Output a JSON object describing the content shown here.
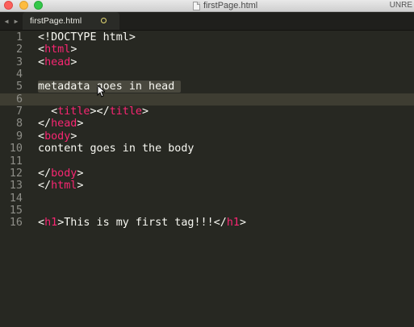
{
  "window": {
    "title": "firstPage.html",
    "unregistered": "UNRE"
  },
  "tab": {
    "label": "firstPage.html"
  },
  "editor": {
    "lines": [
      {
        "n": "1",
        "tokens": [
          {
            "c": "p",
            "v": "<!DOCTYPE html>"
          }
        ]
      },
      {
        "n": "2",
        "tokens": [
          {
            "c": "p",
            "v": "<"
          },
          {
            "c": "t",
            "v": "html"
          },
          {
            "c": "p",
            "v": ">"
          }
        ]
      },
      {
        "n": "3",
        "tokens": [
          {
            "c": "p",
            "v": "<"
          },
          {
            "c": "t",
            "v": "head"
          },
          {
            "c": "p",
            "v": ">"
          }
        ]
      },
      {
        "n": "4",
        "tokens": []
      },
      {
        "n": "5",
        "tokens": [
          {
            "c": "txt sel",
            "v": "metadata goes in head "
          }
        ]
      },
      {
        "n": "6",
        "tokens": []
      },
      {
        "n": "7",
        "tokens": [
          {
            "c": "p",
            "v": "  <"
          },
          {
            "c": "t",
            "v": "title"
          },
          {
            "c": "p",
            "v": "></"
          },
          {
            "c": "t",
            "v": "title"
          },
          {
            "c": "p",
            "v": ">"
          }
        ]
      },
      {
        "n": "8",
        "tokens": [
          {
            "c": "p",
            "v": "</"
          },
          {
            "c": "t",
            "v": "head"
          },
          {
            "c": "p",
            "v": ">"
          }
        ]
      },
      {
        "n": "9",
        "tokens": [
          {
            "c": "p",
            "v": "<"
          },
          {
            "c": "t",
            "v": "body"
          },
          {
            "c": "p",
            "v": ">"
          }
        ]
      },
      {
        "n": "10",
        "tokens": [
          {
            "c": "txt",
            "v": "content goes in the body"
          }
        ]
      },
      {
        "n": "11",
        "tokens": []
      },
      {
        "n": "12",
        "tokens": [
          {
            "c": "p",
            "v": "</"
          },
          {
            "c": "t",
            "v": "body"
          },
          {
            "c": "p",
            "v": ">"
          }
        ]
      },
      {
        "n": "13",
        "tokens": [
          {
            "c": "p",
            "v": "</"
          },
          {
            "c": "t",
            "v": "html"
          },
          {
            "c": "p",
            "v": ">"
          }
        ]
      },
      {
        "n": "14",
        "tokens": []
      },
      {
        "n": "15",
        "tokens": []
      },
      {
        "n": "16",
        "tokens": [
          {
            "c": "p",
            "v": "<"
          },
          {
            "c": "t",
            "v": "h1"
          },
          {
            "c": "p",
            "v": ">"
          },
          {
            "c": "txt",
            "v": "This is my first tag!!!"
          },
          {
            "c": "p",
            "v": "</"
          },
          {
            "c": "t",
            "v": "h1"
          },
          {
            "c": "p",
            "v": ">"
          }
        ]
      }
    ]
  },
  "colors": {
    "background": "#272822",
    "tag": "#f92672",
    "text": "#f8f8f2",
    "line_number": "#8e8e88",
    "selection": "#49483e"
  },
  "icons": {
    "close": "close-button",
    "minimize": "minimize-button",
    "maximize": "maximize-button",
    "document": "document-icon",
    "nav_left": "chevron-left-icon",
    "nav_right": "chevron-right-icon",
    "dirty": "unsaved-dot-icon",
    "mouse": "mouse-pointer-icon"
  }
}
